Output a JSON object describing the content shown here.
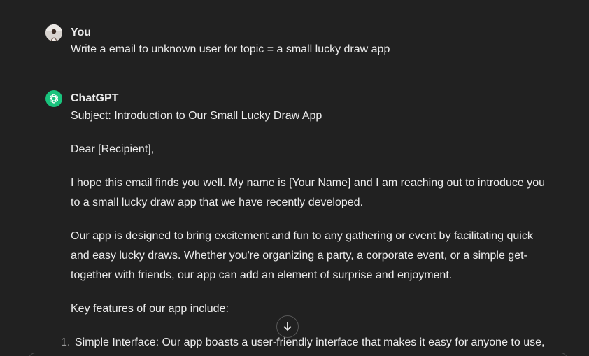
{
  "user_message": {
    "author": "You",
    "text": "Write a email to unknown user for topic = a small lucky draw app"
  },
  "assistant_message": {
    "author": "ChatGPT",
    "paragraphs": [
      "Subject: Introduction to Our Small Lucky Draw App",
      "Dear [Recipient],",
      "I hope this email finds you well. My name is [Your Name] and I am reaching out to introduce you to a small lucky draw app that we have recently developed.",
      "Our app is designed to bring excitement and fun to any gathering or event by facilitating quick and easy lucky draws. Whether you're organizing a party, a corporate event, or a simple get-together with friends, our app can add an element of surprise and enjoyment.",
      "Key features of our app include:"
    ],
    "list": [
      {
        "number": "1.",
        "text": "Simple Interface: Our app boasts a user-friendly interface that makes it easy for anyone to use,"
      }
    ]
  },
  "icons": {
    "assistant_avatar": "openai-logo-icon",
    "scroll_down": "arrow-down-icon"
  },
  "colors": {
    "background": "#212121",
    "text": "#ececec",
    "assistant_avatar_bg": "#19c37d"
  }
}
